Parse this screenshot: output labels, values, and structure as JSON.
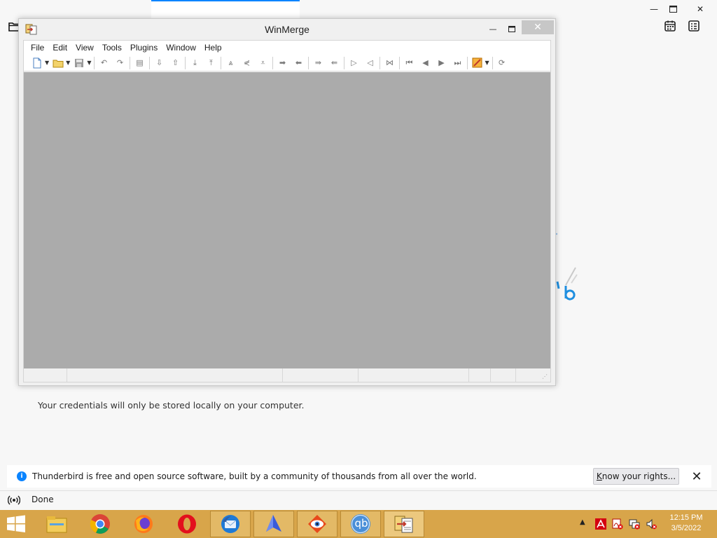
{
  "thunderbird": {
    "window_controls": {
      "minimize": "—",
      "maximize": "☐",
      "close": "✕"
    },
    "credentials_note": "Your credentials will only be stored locally on your computer.",
    "notification": {
      "text": "Thunderbird is free and open source software, built by a community of thousands from all over the world.",
      "button_accesskey": "K",
      "button_rest": "now your rights...",
      "close": "✕"
    },
    "status": "Done",
    "accent_color": "#0a84ff"
  },
  "winmerge": {
    "title": "WinMerge",
    "window_controls": {
      "minimize": "—",
      "close": "✕"
    },
    "menu": [
      "File",
      "Edit",
      "View",
      "Tools",
      "Plugins",
      "Window",
      "Help"
    ],
    "toolbar_icons": [
      "new-document-icon",
      "open-folder-icon",
      "save-icon",
      "undo-icon",
      "redo-icon",
      "print-icon",
      "next-diff-icon",
      "prev-diff-icon",
      "first-diff-icon",
      "last-diff-icon",
      "current-diff-icon",
      "next-conflict-icon",
      "prev-conflict-icon",
      "copy-right-icon",
      "copy-left-icon",
      "copy-right-advance-icon",
      "copy-left-advance-icon",
      "copy-all-right-icon",
      "copy-all-left-icon",
      "merge-icon",
      "first-file-icon",
      "prev-file-icon",
      "next-file-icon",
      "last-file-icon",
      "options-icon",
      "refresh-icon"
    ],
    "client_background": "#ababab"
  },
  "taskbar": {
    "apps": [
      "file-explorer-icon",
      "chrome-icon",
      "firefox-icon",
      "opera-icon",
      "thunderbird-icon",
      "kite-icon",
      "image-viewer-icon",
      "qbittorrent-icon",
      "winmerge-icon"
    ],
    "qbittorrent_label": "qb",
    "tray_icons": [
      "avira-icon",
      "acrobat-icon",
      "network-icon",
      "volume-muted-icon"
    ],
    "time": "12:15 PM",
    "date": "3/5/2022",
    "background_color": "#d8a54a"
  }
}
